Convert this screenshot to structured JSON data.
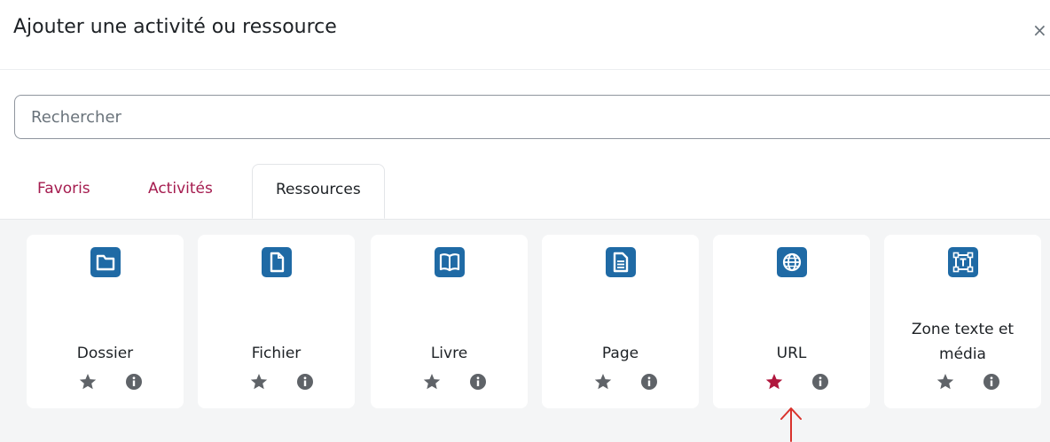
{
  "modal": {
    "title": "Ajouter une activité ou ressource",
    "close_label": "×"
  },
  "search": {
    "placeholder": "Rechercher"
  },
  "tabs": [
    {
      "label": "Favoris"
    },
    {
      "label": "Activités"
    },
    {
      "label": "Ressources",
      "active": true
    }
  ],
  "items": [
    {
      "name": "Dossier",
      "icon": "folder-icon",
      "starred": false
    },
    {
      "name": "Fichier",
      "icon": "file-icon",
      "starred": false
    },
    {
      "name": "Livre",
      "icon": "book-icon",
      "starred": false
    },
    {
      "name": "Page",
      "icon": "page-icon",
      "starred": false
    },
    {
      "name": "URL",
      "icon": "globe-icon",
      "starred": true
    },
    {
      "name_line1": "Zone texte et",
      "name_line2": "média",
      "icon": "text-media-icon",
      "starred": false
    }
  ],
  "colors": {
    "icon_bg": "#1f6aa5",
    "tab_link": "#a51c4f",
    "star_active": "#b0173d",
    "star_inactive": "#5f6368",
    "annotation_arrow": "#d9322c"
  }
}
